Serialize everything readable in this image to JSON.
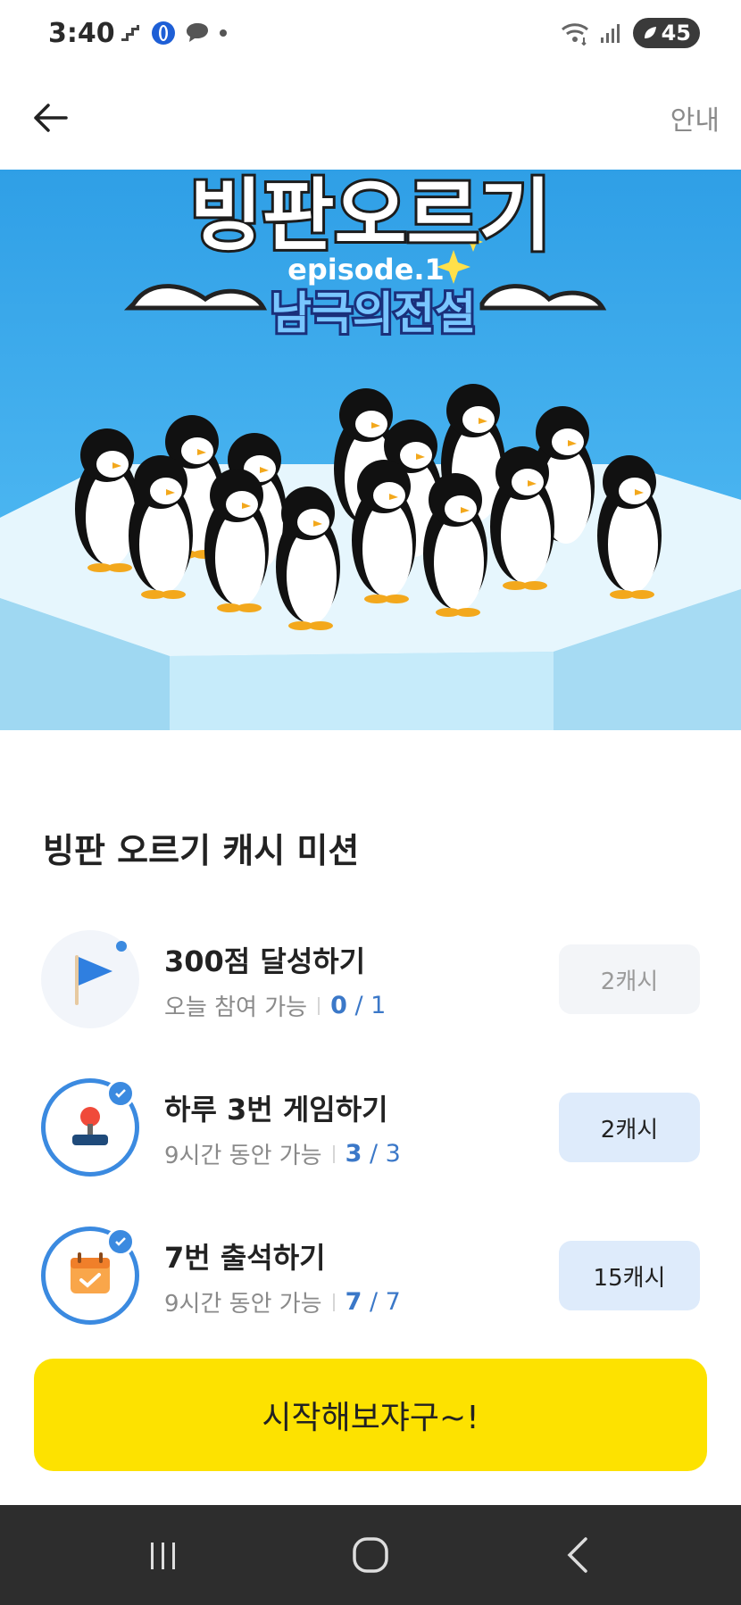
{
  "status_bar": {
    "time": "3:40",
    "battery": "45"
  },
  "app_bar": {
    "guide_label": "안내"
  },
  "banner": {
    "title": "빙판오르기",
    "episode": "episode.1",
    "subtitle": "남극의전설"
  },
  "section": {
    "title": "빙판 오르기 캐시 미션"
  },
  "missions": [
    {
      "title": "300점 달성하기",
      "condition": "오늘 참여 가능",
      "progress": "0",
      "total": "1",
      "reward": "2캐시",
      "completed": false
    },
    {
      "title": "하루 3번 게임하기",
      "condition": "9시간 동안 가능",
      "progress": "3",
      "total": "3",
      "reward": "2캐시",
      "completed": true
    },
    {
      "title": "7번 출석하기",
      "condition": "9시간 동안 가능",
      "progress": "7",
      "total": "7",
      "reward": "15캐시",
      "completed": true
    }
  ],
  "cta": {
    "label": "시작해보쟈구~!"
  },
  "colors": {
    "accent": "#3b78c8",
    "cta": "#fde200",
    "reward_active_bg": "#deebfb"
  }
}
